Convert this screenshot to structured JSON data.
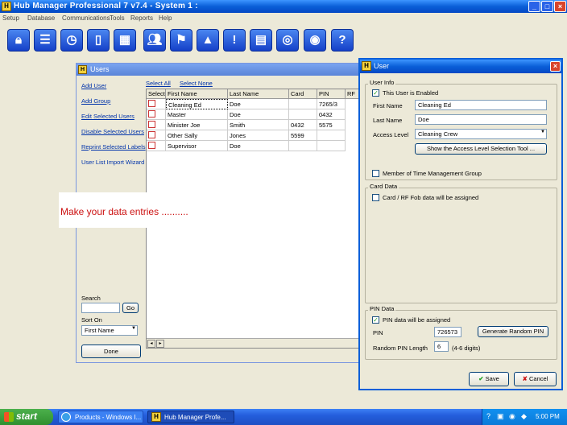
{
  "app": {
    "title": "Hub Manager Professional 7 v7.4 - System 1 :",
    "menu": [
      "Setup",
      "Database",
      "Communications",
      "Tools",
      "Reports",
      "Help"
    ],
    "toolbar": [
      "lock-icon",
      "list-icon",
      "clock-icon",
      "door-icon",
      "calendar-icon",
      "users-icon",
      "flag-icon",
      "eject-icon",
      "alert-icon",
      "document-icon",
      "network-icon",
      "target-icon",
      "help-icon"
    ]
  },
  "users_window": {
    "title": "Users",
    "links": [
      "Add User",
      "Add Group",
      "Edit Selected Users",
      "Disable Selected Users",
      "Reprint Selected Labels",
      "User List Import Wizard"
    ],
    "select_all": "Select All",
    "select_none": "Select None",
    "columns": [
      "Select",
      "First Name",
      "Last Name",
      "Card",
      "PIN",
      "RF"
    ],
    "rows": [
      {
        "first": "Cleaning Ed",
        "last": "Doe",
        "card": "",
        "pin": "7265/3"
      },
      {
        "first": "Master",
        "last": "Doe",
        "card": "",
        "pin": "0432"
      },
      {
        "first": "Minister Joe",
        "last": "Smith",
        "card": "0432",
        "pin": "5575"
      },
      {
        "first": "Other Sally",
        "last": "Jones",
        "card": "5599",
        "pin": ""
      },
      {
        "first": "Supervisor",
        "last": "Doe",
        "card": "",
        "pin": ""
      }
    ],
    "search_label": "Search",
    "search_go": "Go",
    "sort_label": "Sort On",
    "sort_value": "First Name",
    "done": "Done"
  },
  "message": "Make your data entries ..........",
  "user_dialog": {
    "title": "User",
    "user_info_label": "User Info",
    "enabled_label": "This User is Enabled",
    "first_name_label": "First Name",
    "first_name_value": "Cleaning Ed",
    "last_name_label": "Last Name",
    "last_name_value": "Doe",
    "access_level_label": "Access Level",
    "access_level_value": "Cleaning Crew",
    "show_access_button": "Show the Access Level Selection Tool ...",
    "member_label": "Member of Time Management Group",
    "card_data_label": "Card Data",
    "card_checkbox_label": "Card / RF Fob data will be assigned",
    "pin_data_label": "PIN Data",
    "pin_checkbox_label": "PIN data will be assigned",
    "pin_label": "PIN",
    "pin_value": "726573",
    "generate_button": "Generate Random PIN",
    "random_length_label": "Random PIN Length",
    "random_length_value": "6",
    "digits_label": "(4-6 digits)",
    "save": "Save",
    "cancel": "Cancel"
  },
  "taskbar": {
    "start": "start",
    "tasks": [
      "Products - Windows I...",
      "Hub Manager Profe..."
    ],
    "clock": "5:00 PM"
  },
  "colors": {
    "xp_blue": "#0a5fd8",
    "message_red": "#cc1111",
    "start_green": "#2f8f2f"
  }
}
